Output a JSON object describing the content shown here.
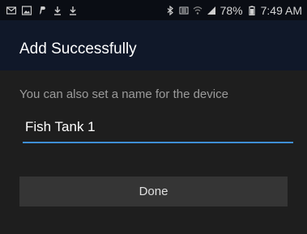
{
  "status_bar": {
    "left_icons": [
      "mail-icon",
      "image-icon",
      "paypal-icon",
      "download-icon",
      "download-icon"
    ],
    "right_icons": [
      "bluetooth-icon",
      "volte-icon",
      "wifi-icon",
      "signal-icon"
    ],
    "battery_text": "78%",
    "time": "7:49 AM"
  },
  "dialog": {
    "title": "Add Successfully",
    "prompt": "You can also set a name for the device",
    "name_value": "Fish Tank 1",
    "done_label": "Done"
  },
  "colors": {
    "header_bg": "#101829",
    "accent_underline": "#3f8fd6",
    "button_bg": "#353535"
  }
}
